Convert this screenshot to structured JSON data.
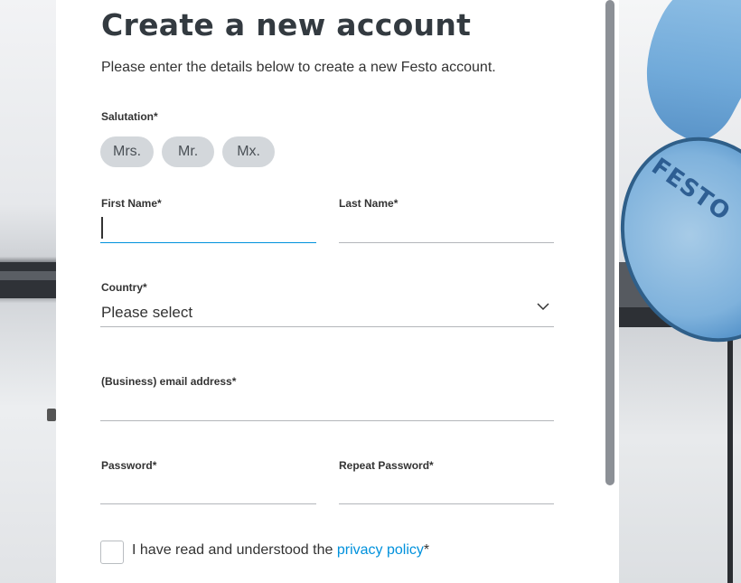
{
  "page": {
    "title": "Create a new account",
    "subtitle": "Please enter the details below to create a new Festo account."
  },
  "salutation": {
    "label": "Salutation*",
    "options": [
      "Mrs.",
      "Mr.",
      "Mx."
    ]
  },
  "first_name": {
    "label": "First Name*",
    "value": ""
  },
  "last_name": {
    "label": "Last Name*",
    "value": ""
  },
  "country": {
    "label": "Country*",
    "value": "Please select"
  },
  "email": {
    "label": "(Business) email address*",
    "value": ""
  },
  "password": {
    "label": "Password*",
    "value": ""
  },
  "repeat_password": {
    "label": "Repeat Password*",
    "value": ""
  },
  "consent": {
    "prefix": "I have read and understood the ",
    "link": "privacy policy",
    "suffix": "*",
    "checked": false
  },
  "background": {
    "brand_on_disc": "FESTO"
  },
  "colors": {
    "accent": "#0091dc",
    "pill_bg": "#d3d7db",
    "line": "#b3b6ba"
  }
}
